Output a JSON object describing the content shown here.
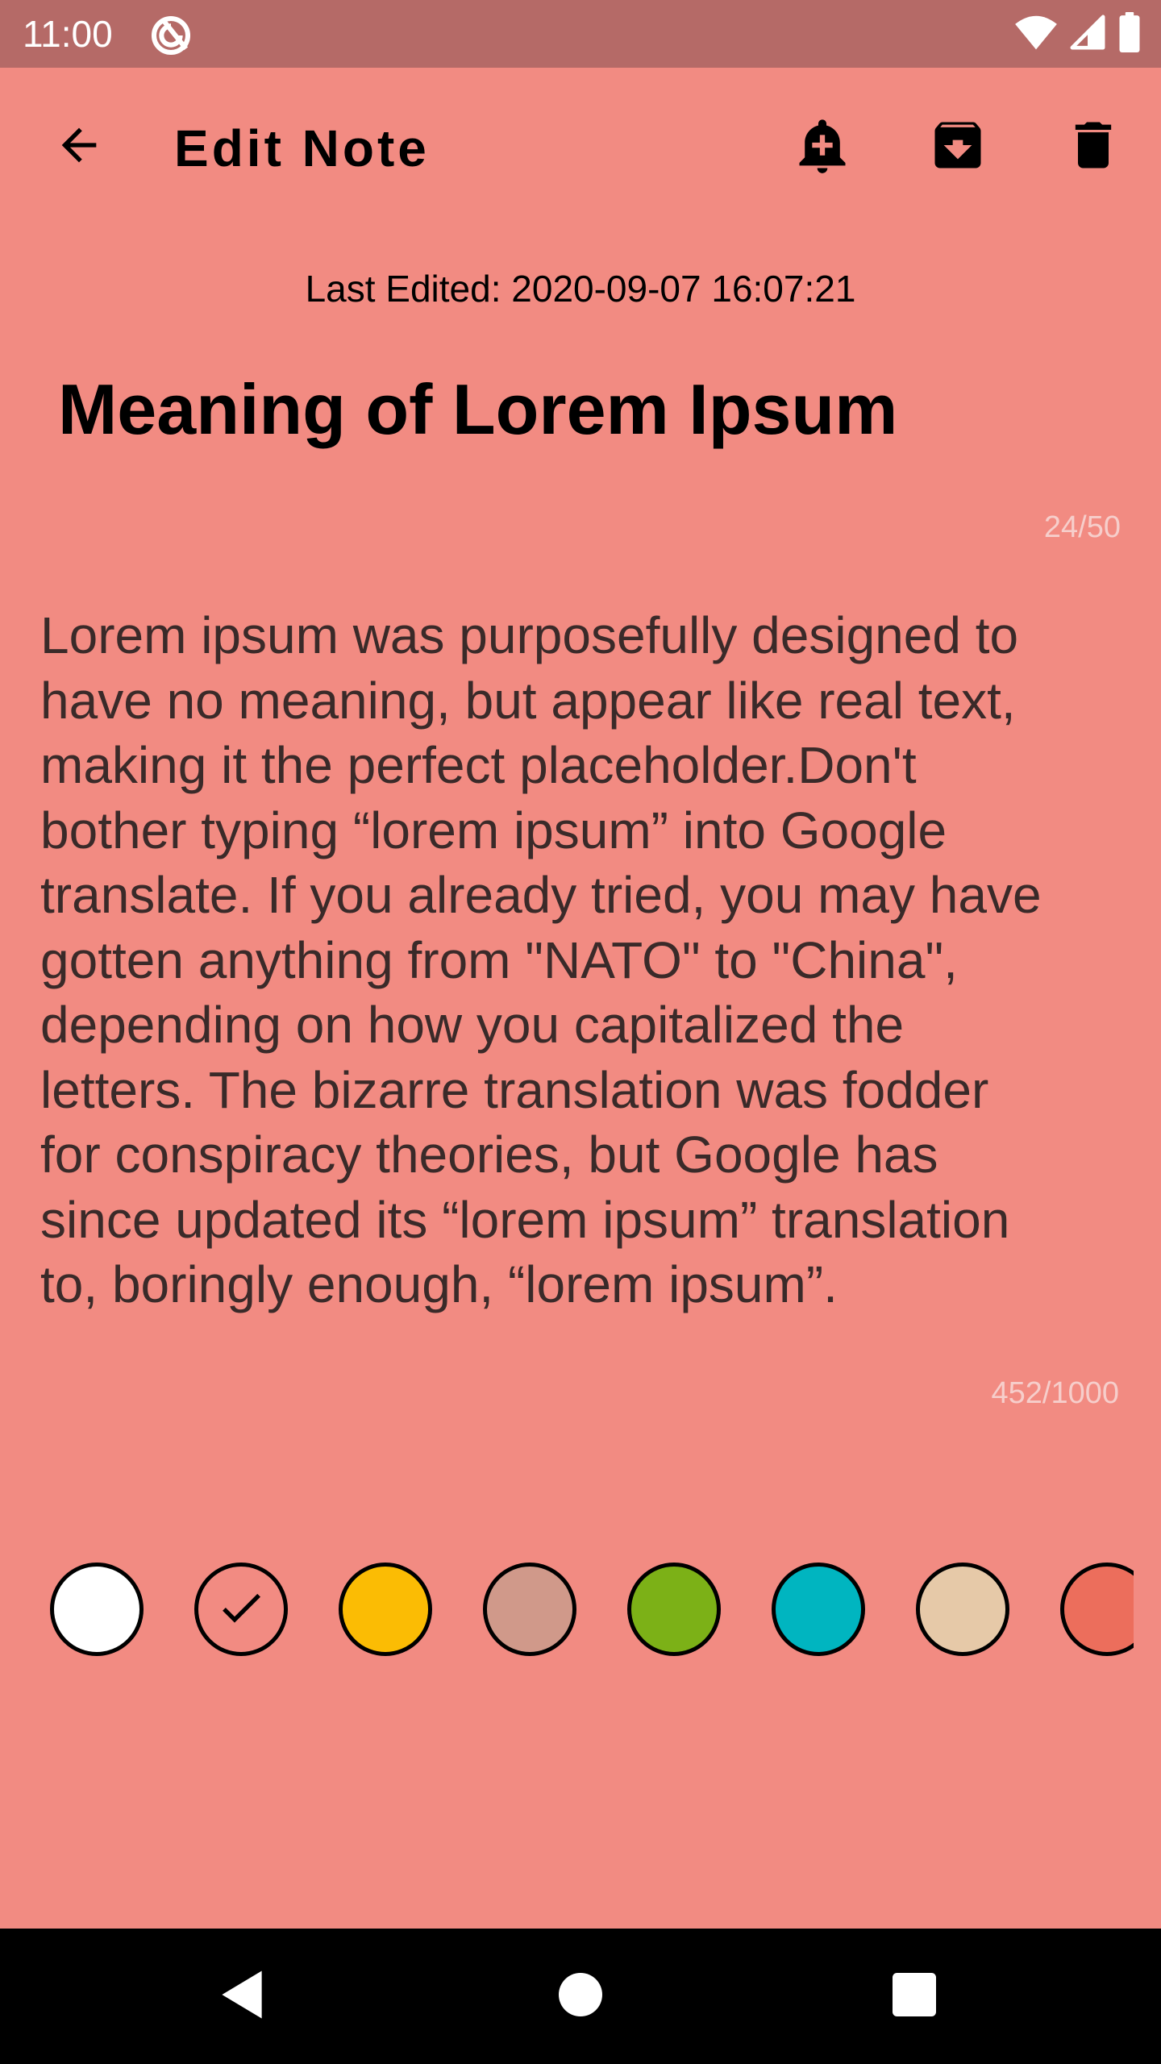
{
  "status_bar": {
    "time": "11:00"
  },
  "app_bar": {
    "title": "Edit Note",
    "icons": [
      "back-arrow-icon",
      "add-reminder-bell-icon",
      "archive-icon",
      "delete-trash-icon"
    ]
  },
  "note": {
    "last_edited": "Last Edited: 2020-09-07 16:07:21",
    "title": "Meaning of Lorem Ipsum",
    "title_counter": "24/50",
    "body": "Lorem ipsum was purposefully designed to\nhave no meaning, but appear like real text,\nmaking it the perfect placeholder.Don't\nbother typing “lorem ipsum” into Google\ntranslate. If you already tried, you may have\ngotten anything from \"NATO\" to \"China\",\ndepending on how you capitalized the\nletters. The bizarre translation was fodder\nfor conspiracy theories, but Google has\nsince updated its “lorem ipsum” translation\nto, boringly enough, “lorem ipsum”.",
    "body_counter": "452/1000"
  },
  "palette": {
    "colors": [
      "#FFFFFF",
      "#F28B82",
      "#FBBC04",
      "#D0998A",
      "#7CB117",
      "#00B5C0",
      "#E6C9A8",
      "#EC6E5C"
    ],
    "selected_index": 1
  },
  "theme": {
    "background": "#F28B82",
    "status_bar": "#B56A67",
    "nav_bar": "#000000"
  }
}
